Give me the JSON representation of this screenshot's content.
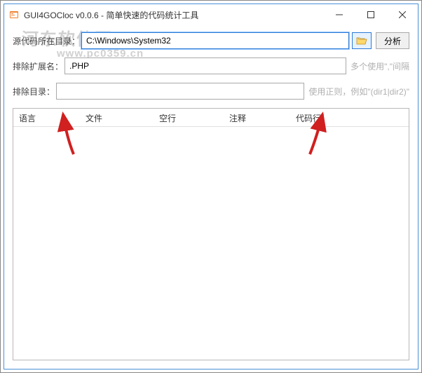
{
  "window": {
    "title": "GUI4GOCloc v0.0.6 - 简单快速的代码统计工具"
  },
  "watermark": {
    "brand": "河东软件园",
    "url": "www.pc0359.cn"
  },
  "form": {
    "source_dir_label": "源代码所在目录：",
    "source_dir_value": "C:\\Windows\\System32",
    "analyze_btn": "分析",
    "exclude_ext_label": "排除扩展名：",
    "exclude_ext_value": ".PHP",
    "exclude_ext_hint": "多个使用\",\"间隔",
    "exclude_dir_label": "排除目录：",
    "exclude_dir_value": "",
    "exclude_dir_hint": "使用正则，例如\"(dir1|dir2)\""
  },
  "table": {
    "columns": [
      "语言",
      "文件",
      "空行",
      "注释",
      "代码行"
    ]
  }
}
